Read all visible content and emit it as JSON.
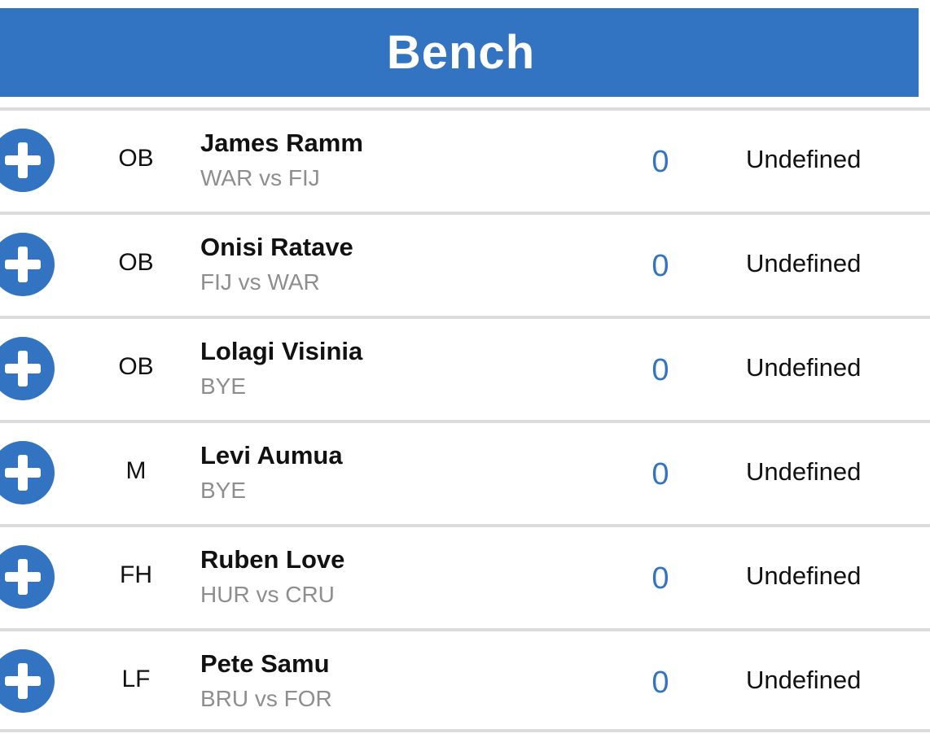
{
  "header": {
    "title": "Bench"
  },
  "colors": {
    "accent": "#3374c2",
    "divider": "#dcdcdc",
    "muted": "#8e8e8e"
  },
  "rows": [
    {
      "position": "OB",
      "name": "James Ramm",
      "fixture": "WAR vs FIJ",
      "points": "0",
      "status": "Undefined",
      "icon": "plus-circle-icon"
    },
    {
      "position": "OB",
      "name": "Onisi Ratave",
      "fixture": "FIJ vs WAR",
      "points": "0",
      "status": "Undefined",
      "icon": "plus-circle-icon"
    },
    {
      "position": "OB",
      "name": "Lolagi Visinia",
      "fixture": "BYE",
      "points": "0",
      "status": "Undefined",
      "icon": "plus-circle-icon"
    },
    {
      "position": "M",
      "name": "Levi Aumua",
      "fixture": "BYE",
      "points": "0",
      "status": "Undefined",
      "icon": "plus-circle-icon"
    },
    {
      "position": "FH",
      "name": "Ruben Love",
      "fixture": "HUR vs CRU",
      "points": "0",
      "status": "Undefined",
      "icon": "plus-circle-icon"
    },
    {
      "position": "LF",
      "name": "Pete Samu",
      "fixture": "BRU vs FOR",
      "points": "0",
      "status": "Undefined",
      "icon": "plus-circle-icon"
    }
  ]
}
